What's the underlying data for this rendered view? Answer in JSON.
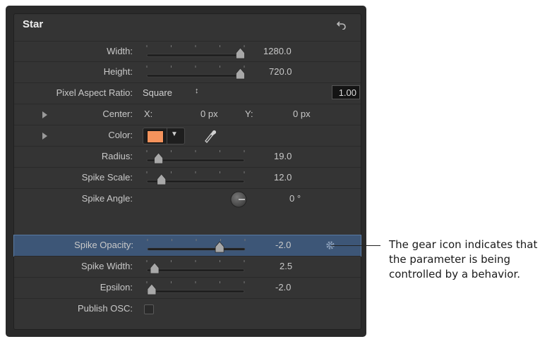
{
  "panel": {
    "title": "Star",
    "reset_icon": "reset-arrow-icon",
    "rows": {
      "width": {
        "label": "Width:",
        "value": "1280.0",
        "slider_fraction": 0.96
      },
      "height": {
        "label": "Height:",
        "value": "720.0",
        "slider_fraction": 0.96
      },
      "pixel_aspect": {
        "label": "Pixel Aspect Ratio:",
        "popup_value": "Square",
        "popup_arrow": "↕",
        "number": "1.00"
      },
      "center": {
        "label": "Center:",
        "x_label": "X:",
        "x_value": "0 px",
        "y_label": "Y:",
        "y_value": "0 px"
      },
      "color": {
        "label": "Color:",
        "swatch_color": "#f5935c",
        "dropdown_arrow": "▼",
        "eyedropper_icon": "eyedropper-icon"
      },
      "radius": {
        "label": "Radius:",
        "value": "19.0",
        "slider_fraction": 0.12
      },
      "spike_scale": {
        "label": "Spike Scale:",
        "value": "12.0",
        "slider_fraction": 0.15
      },
      "spike_angle": {
        "label": "Spike Angle:",
        "value": "0 °",
        "dial_icon": "angle-dial-icon"
      },
      "spike_opacity": {
        "label": "Spike Opacity:",
        "value": "-2.0",
        "slider_fraction": 0.74,
        "gear_icon": "gear-icon"
      },
      "spike_width": {
        "label": "Spike Width:",
        "value": "2.5",
        "slider_fraction": 0.08
      },
      "epsilon": {
        "label": "Epsilon:",
        "value": "-2.0",
        "slider_fraction": 0.05
      },
      "publish_osc": {
        "label": "Publish OSC:",
        "checked": false
      }
    }
  },
  "callout": {
    "lines": [
      "The gear icon indicates that",
      "the parameter is being",
      "controlled by a behavior."
    ]
  }
}
